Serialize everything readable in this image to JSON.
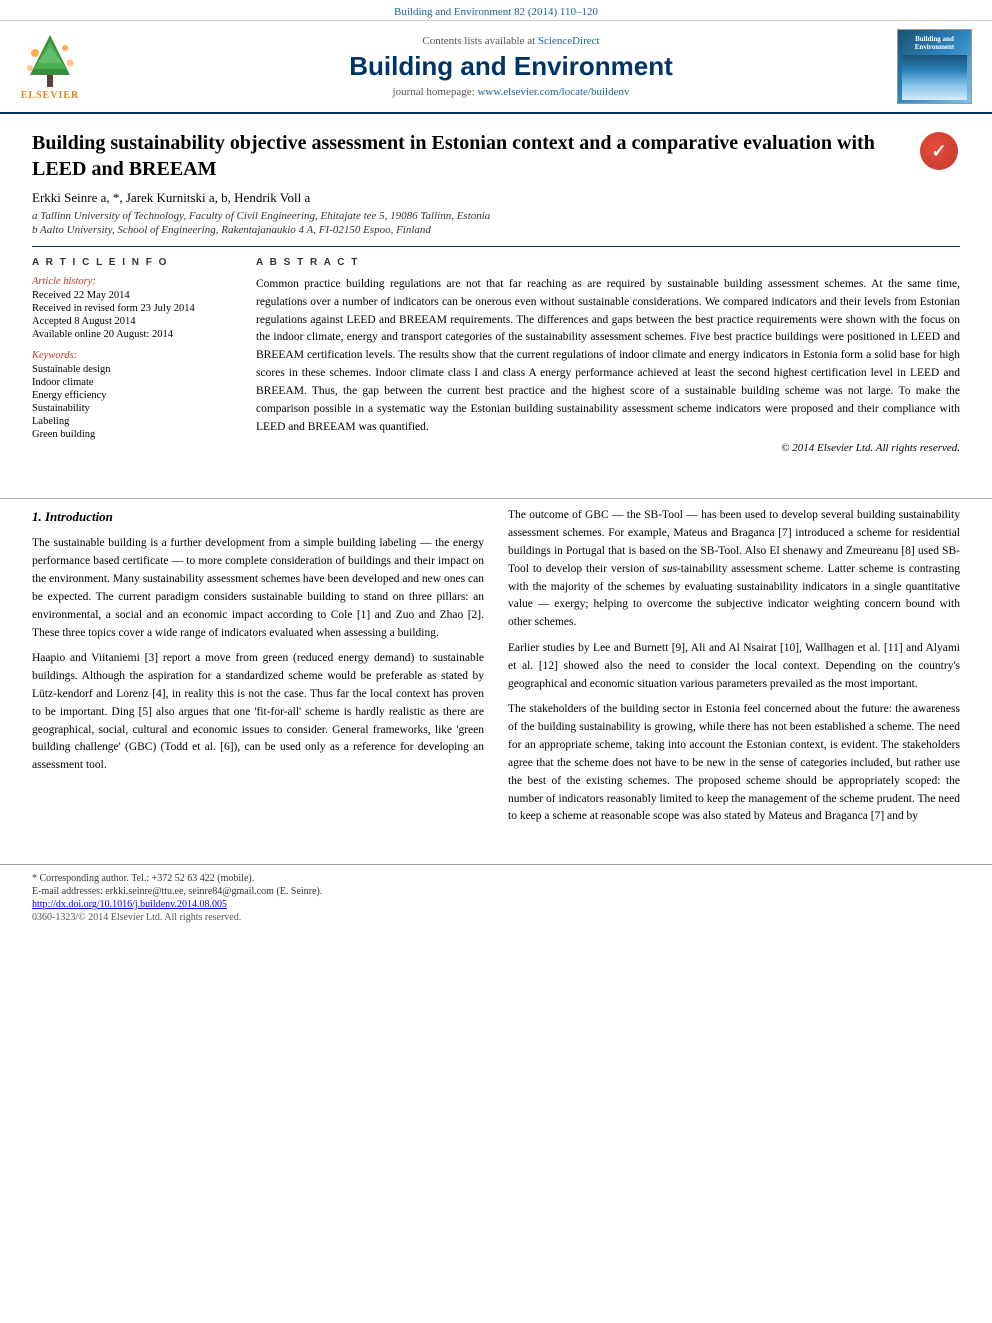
{
  "topbar": {
    "citation": "Building and Environment 82 (2014) 110–120"
  },
  "header": {
    "sciencedirect_text": "Contents lists available at",
    "sciencedirect_link": "ScienceDirect",
    "journal_title": "Building and Environment",
    "homepage_label": "journal homepage:",
    "homepage_url": "www.elsevier.com/locate/buildenv",
    "elsevier_label": "ELSEVIER",
    "cover_title": "Building and\nEnvironment"
  },
  "article": {
    "title": "Building sustainability objective assessment in Estonian context and a comparative evaluation with LEED and BREEAM",
    "authors": "Erkki Seinre a, *, Jarek Kurnitski a, b, Hendrik Voll a",
    "affiliation_a": "a Tallinn University of Technology, Faculty of Civil Engineering, Ehitajate tee 5, 19086 Tallinn, Estonia",
    "affiliation_b": "b Aalto University, School of Engineering, Rakentajanaukio 4 A, FI-02150 Espoo, Finland"
  },
  "article_info": {
    "section_label": "A R T I C L E   I N F O",
    "history_label": "Article history:",
    "received": "Received 22 May 2014",
    "received_revised": "Received in revised form 23 July 2014",
    "accepted": "Accepted 8 August 2014",
    "available": "Available online 20 August: 2014",
    "keywords_label": "Keywords:",
    "keywords": [
      "Sustainable design",
      "Indoor climate",
      "Energy efficiency",
      "Sustainability",
      "Labeling",
      "Green building"
    ]
  },
  "abstract": {
    "section_label": "A B S T R A C T",
    "text": "Common practice building regulations are not that far reaching as are required by sustainable building assessment schemes. At the same time, regulations over a number of indicators can be onerous even without sustainable considerations. We compared indicators and their levels from Estonian regulations against LEED and BREEAM requirements. The differences and gaps between the best practice requirements were shown with the focus on the indoor climate, energy and transport categories of the sustainability assessment schemes. Five best practice buildings were positioned in LEED and BREEAM certification levels. The results show that the current regulations of indoor climate and energy indicators in Estonia form a solid base for high scores in these schemes. Indoor climate class I and class A energy performance achieved at least the second highest certification level in LEED and BREEAM. Thus, the gap between the current best practice and the highest score of a sustainable building scheme was not large. To make the comparison possible in a systematic way the Estonian building sustainability assessment scheme indicators were proposed and their compliance with LEED and BREEAM was quantified.",
    "copyright": "© 2014 Elsevier Ltd. All rights reserved."
  },
  "intro": {
    "heading": "1.  Introduction",
    "para1": "The sustainable building is a further development from a simple building labeling — the energy performance based certificate — to more complete consideration of buildings and their impact on the environment. Many sustainability assessment schemes have been developed and new ones can be expected. The current paradigm considers sustainable building to stand on three pillars: an environmental, a social and an economic impact according to Cole [1] and Zuo and Zhao [2]. These three topics cover a wide range of indicators evaluated when assessing a building.",
    "para2": "Haapio and Viitaniemi [3] report a move from green (reduced energy demand) to sustainable buildings. Although the aspiration for a standardized scheme would be preferable as stated by Lütz-kendorf and Lorenz [4], in reality this is not the case. Thus far the local context has proven to be important. Ding [5] also argues that one 'fit-for-all' scheme is hardly realistic as there are geographical, social, cultural and economic issues to consider. General frameworks, like 'green building challenge' (GBC) (Todd et al. [6]), can be used only as a reference for developing an assessment tool.",
    "para3": "The outcome of GBC — the SB-Tool — has been used to develop several building sustainability assessment schemes. For example, Mateus and Braganca [7] introduced a scheme for residential buildings in Portugal that is based on the SB-Tool. Also El shenawy and Zmeureanu [8] used SB-Tool to develop their version of sustainability assessment scheme. Latter scheme is contrasting with the majority of the schemes by evaluating sustainability indicators in a single quantitative value — exergy; helping to overcome the subjective indicator weighting concern bound with other schemes.",
    "para4": "Earlier studies by Lee and Burnett [9], Ali and Al Nsairat [10], Wallhagen et al. [11] and Alyami et al. [12] showed also the need to consider the local context. Depending on the country's geographical and economic situation various parameters prevailed as the most important.",
    "para5": "The stakeholders of the building sector in Estonia feel concerned about the future: the awareness of the building sustainability is growing, while there has not been established a scheme. The need for an appropriate scheme, taking into account the Estonian context, is evident. The stakeholders agree that the scheme does not have to be new in the sense of categories included, but rather use the best of the existing schemes. The proposed scheme should be appropriately scoped: the number of indicators reasonably limited to keep the management of the scheme prudent. The need to keep a scheme at reasonable scope was also stated by Mateus and Braganca [7] and by"
  },
  "footnotes": {
    "corresponding": "* Corresponding author. Tel.: +372 52 63 422 (mobile).",
    "emails": "E-mail addresses: erkki.seinre@ttu.ee, seinre84@gmail.com (E. Seinre).",
    "doi": "http://dx.doi.org/10.1016/j.buildenv.2014.08.005",
    "issn": "0360-1323/© 2014 Elsevier Ltd. All rights reserved."
  }
}
